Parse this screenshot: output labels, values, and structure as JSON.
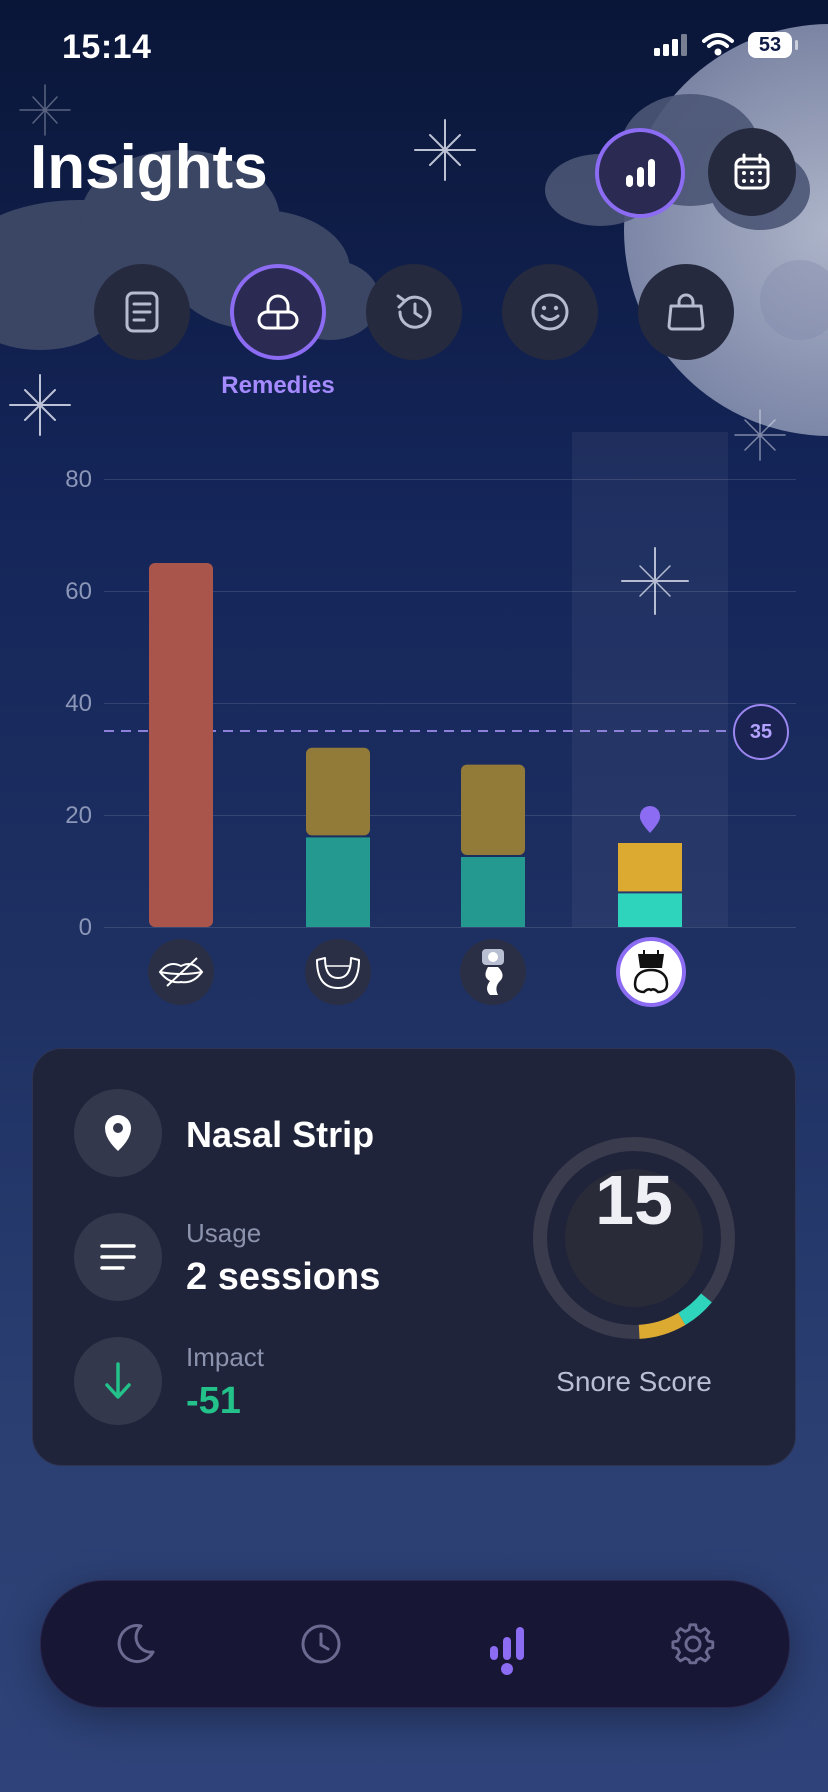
{
  "status_bar": {
    "time": "15:14",
    "battery": "53"
  },
  "header": {
    "title": "Insights"
  },
  "view_toggle": [
    {
      "name": "chart-view",
      "icon": "bar-chart-icon",
      "active": true
    },
    {
      "name": "calendar-view",
      "icon": "calendar-icon",
      "active": false
    }
  ],
  "category_tabs": [
    {
      "name": "notes",
      "icon": "notes-icon",
      "active": false
    },
    {
      "name": "remedies",
      "icon": "pill-icon",
      "active": true,
      "label": "Remedies"
    },
    {
      "name": "history",
      "icon": "history-icon",
      "active": false
    },
    {
      "name": "mood",
      "icon": "smile-icon",
      "active": false
    },
    {
      "name": "purchases",
      "icon": "bag-icon",
      "active": false
    }
  ],
  "chart_data": {
    "type": "bar",
    "stacked": true,
    "ylim": [
      0,
      80
    ],
    "yticks": [
      "0",
      "20",
      "40",
      "60",
      "80"
    ],
    "grid": true,
    "reference_line": {
      "value": 35,
      "label": "35"
    },
    "categories": [
      "no-remedy",
      "mouth-guard",
      "sleep-position",
      "nasal-strip"
    ],
    "category_icons": [
      "lips-crossed-icon",
      "mouth-guard-icon",
      "sleep-position-icon",
      "nasal-strip-icon"
    ],
    "selected_index": 3,
    "series": [
      {
        "values": [
          65,
          16,
          12.5,
          6
        ],
        "colors": [
          "#a9554b",
          "#24998f",
          "#24998f",
          "#2ed4bb"
        ]
      },
      {
        "values": [
          0,
          16,
          16.5,
          9
        ],
        "colors": [
          "#a9554b",
          "#927a38",
          "#927a38",
          "#dcaa30"
        ]
      }
    ]
  },
  "summary": {
    "remedy_name": "Nasal Strip",
    "usage_label": "Usage",
    "usage_value": "2 sessions",
    "impact_label": "Impact",
    "impact_value": "-51",
    "score": "15",
    "score_label": "Snore Score",
    "score_fraction": 0.15,
    "colors": {
      "impact": "#23c28a",
      "accent": "#8b6cf2"
    }
  },
  "bottom_nav": [
    {
      "name": "sleep",
      "icon": "moon-icon",
      "active": false
    },
    {
      "name": "history",
      "icon": "clock-icon",
      "active": false
    },
    {
      "name": "insights",
      "icon": "bar-chart-icon",
      "active": true
    },
    {
      "name": "settings",
      "icon": "gear-icon",
      "active": false
    }
  ]
}
